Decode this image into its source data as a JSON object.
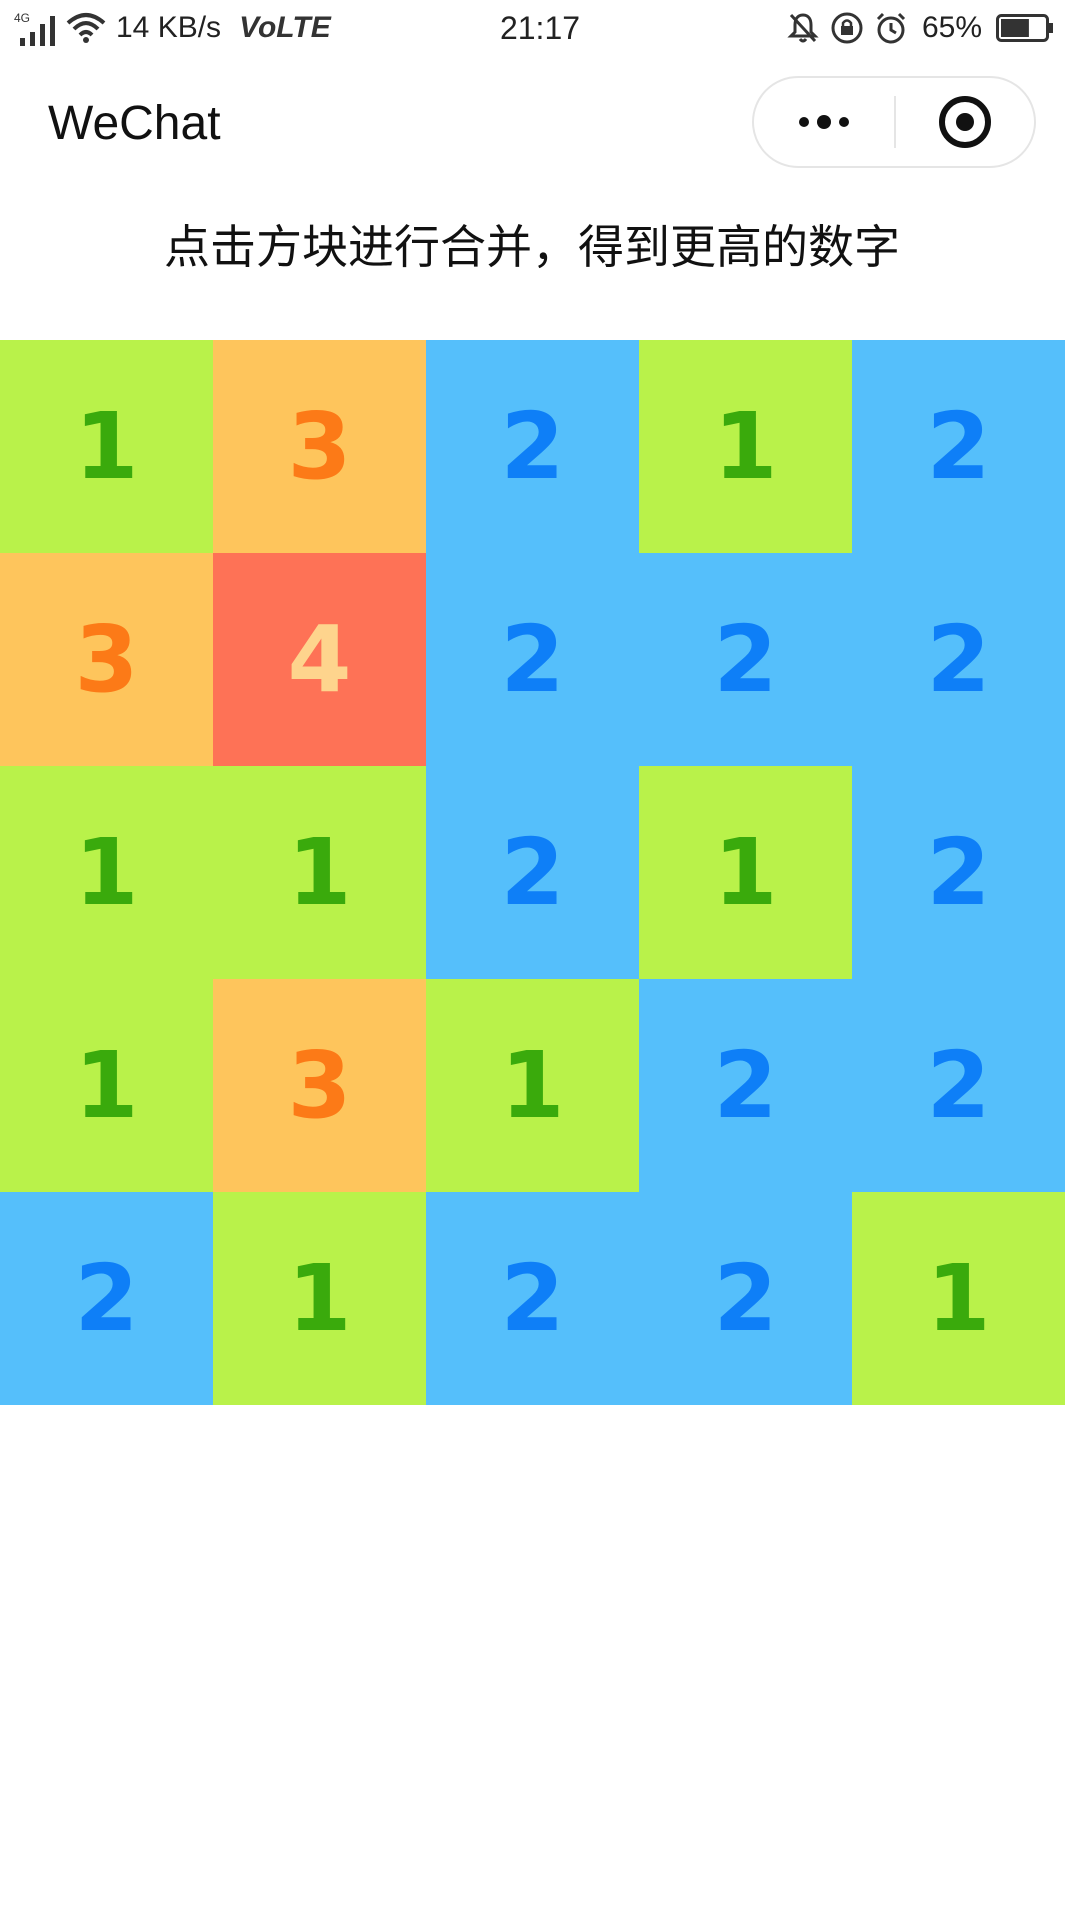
{
  "status_bar": {
    "network": "4G",
    "speed": "14 KB/s",
    "volte": "VoLTE",
    "time": "21:17",
    "battery_percent": "65%",
    "battery_level": 0.65,
    "icons": [
      "signal-icon",
      "wifi-icon",
      "mute-icon",
      "rotation-lock-icon",
      "alarm-icon",
      "battery-icon"
    ]
  },
  "nav": {
    "title": "WeChat",
    "more_icon": "more-dots-icon",
    "close_icon": "close-miniprogram-icon"
  },
  "instruction": "点击方块进行合并，得到更高的数字",
  "board": {
    "rows": [
      [
        "1",
        "3",
        "2",
        "1",
        "2"
      ],
      [
        "3",
        "4",
        "2",
        "2",
        "2"
      ],
      [
        "1",
        "1",
        "2",
        "1",
        "2"
      ],
      [
        "1",
        "3",
        "1",
        "2",
        "2"
      ],
      [
        "2",
        "1",
        "2",
        "2",
        "1"
      ]
    ]
  },
  "colors": {
    "tile_1_bg": "#b9f24a",
    "tile_1_text": "#3aaa0c",
    "tile_2_bg": "#55bffb",
    "tile_2_text": "#0e7ff7",
    "tile_3_bg": "#fec55c",
    "tile_3_text": "#fc7a17",
    "tile_4_bg": "#fe7256",
    "tile_4_text": "#fed48d"
  }
}
